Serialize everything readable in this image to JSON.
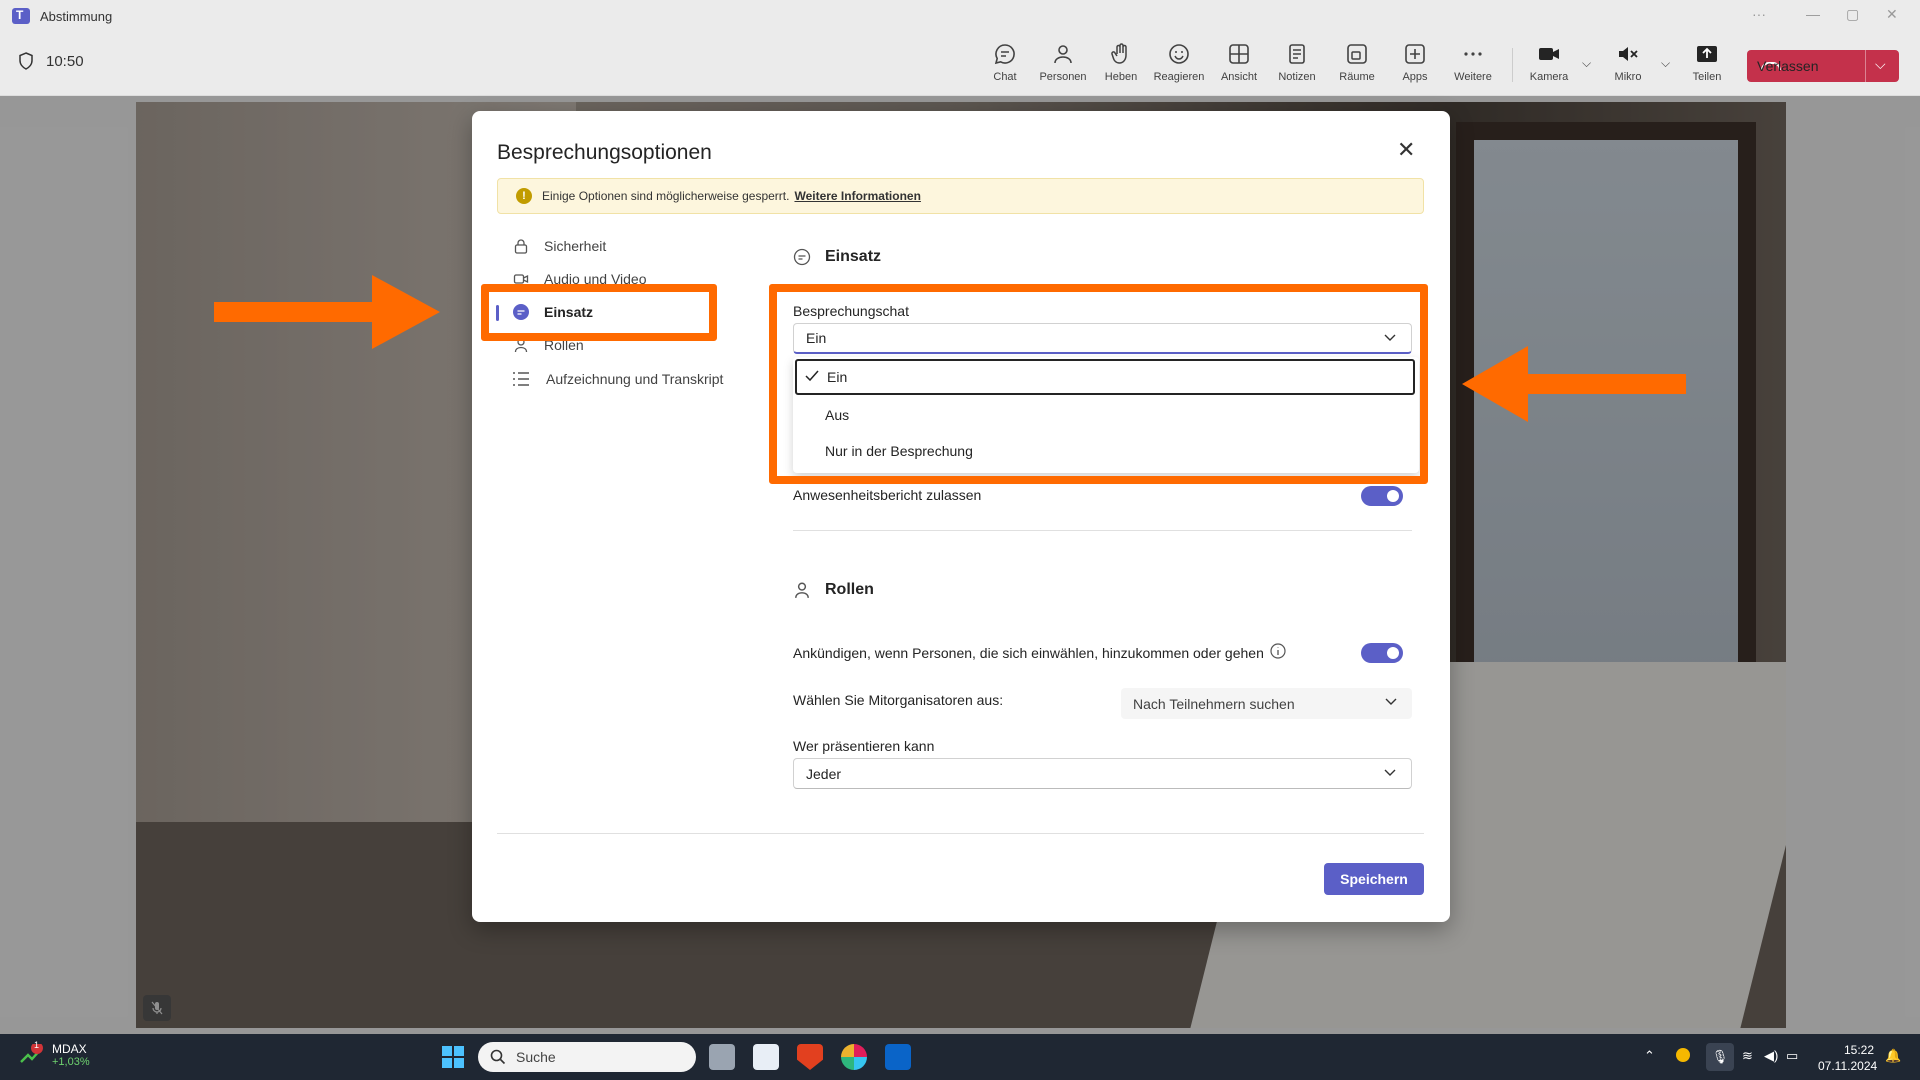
{
  "window": {
    "title": "Abstimmung",
    "more": "···",
    "minimize": "—",
    "maximize": "▢",
    "close": "✕"
  },
  "toolbar": {
    "time": "10:50",
    "buttons": [
      {
        "label": "Chat",
        "icon": "chat-icon"
      },
      {
        "label": "Personen",
        "icon": "people-icon"
      },
      {
        "label": "Heben",
        "icon": "raise-hand-icon"
      },
      {
        "label": "Reagieren",
        "icon": "react-icon"
      },
      {
        "label": "Ansicht",
        "icon": "view-icon"
      },
      {
        "label": "Notizen",
        "icon": "notes-icon"
      },
      {
        "label": "Räume",
        "icon": "rooms-icon"
      },
      {
        "label": "Apps",
        "icon": "apps-icon"
      },
      {
        "label": "Weitere",
        "icon": "more-icon"
      },
      {
        "label": "Kamera",
        "icon": "camera-icon"
      },
      {
        "label": "Mikro",
        "icon": "mic-muted-icon"
      },
      {
        "label": "Teilen",
        "icon": "share-icon"
      }
    ],
    "leave_label": "Verlassen",
    "leave_color": "#c4314b"
  },
  "dialog": {
    "title": "Besprechungsoptionen",
    "warning_text": "Einige Optionen sind möglicherweise gesperrt.",
    "warning_link": "Weitere Informationen",
    "nav": [
      {
        "label": "Sicherheit",
        "icon": "lock-icon",
        "active": false
      },
      {
        "label": "Audio und Video",
        "icon": "video-icon",
        "active": false
      },
      {
        "label": "Einsatz",
        "icon": "chat-bubble-icon",
        "active": true
      },
      {
        "label": "Rollen",
        "icon": "person-icon",
        "active": false
      },
      {
        "label": "Aufzeichnung und Transkript",
        "icon": "list-icon",
        "active": false
      }
    ],
    "sections": {
      "einsatz_title": "Einsatz",
      "chat_label": "Besprechungschat",
      "chat_value": "Ein",
      "chat_options": [
        "Ein",
        "Aus",
        "Nur in der Besprechung"
      ],
      "chat_selected": "Ein",
      "attendance_label": "Anwesenheitsbericht zulassen",
      "attendance_on": true,
      "rollen_title": "Rollen",
      "announce_label": "Ankündigen, wenn Personen, die sich einwählen, hinzukommen oder gehen",
      "announce_on": true,
      "coorg_label": "Wählen Sie Mitorganisatoren aus:",
      "coorg_placeholder": "Nach Teilnehmern suchen",
      "presenter_label": "Wer präsentieren kann",
      "presenter_value": "Jeder"
    },
    "save_label": "Speichern",
    "accent": "#5b5fc7"
  },
  "annotation_color": "#ff6a00",
  "taskbar": {
    "stock_name": "MDAX",
    "stock_change": "+1,03%",
    "stock_badge": "1",
    "search_placeholder": "Suche",
    "time": "15:22",
    "date": "07.11.2024"
  }
}
